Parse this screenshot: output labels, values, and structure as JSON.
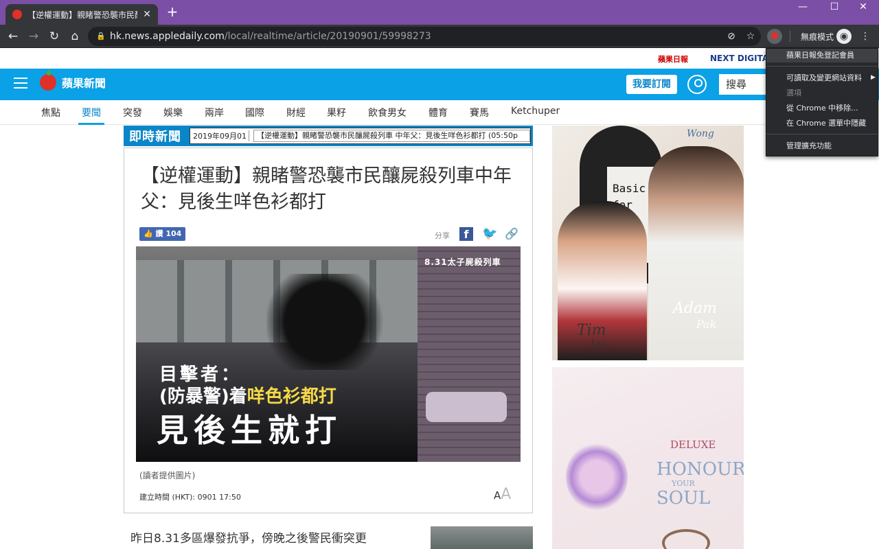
{
  "browser": {
    "tab_title": "【逆權運動】親睹警恐襲市民釀屍",
    "new_tab": "+",
    "url_host": "hk.news.appledaily.com",
    "url_path": "/local/realtime/article/20190901/59998273",
    "incognito_label": "無痕模式",
    "window_controls": {
      "minimize": "—",
      "maximize": "☐",
      "close": "✕"
    }
  },
  "context_menu": {
    "items": [
      {
        "label": "蘋果日報免登記會員",
        "highlighted": true
      },
      {
        "label": "可讀取及變更網站資料",
        "submenu": true
      },
      {
        "label": "選項",
        "disabled": true
      },
      {
        "label": "從 Chrome 中移除..."
      },
      {
        "label": "在 Chrome 選單中隱藏"
      },
      {
        "label": "管理擴充功能"
      }
    ]
  },
  "site": {
    "brand_logos": {
      "apple_daily": "蘋果日報",
      "next_digital": "NEXT DIGITAL"
    },
    "logo_text": "蘋果新聞",
    "subscribe_label": "我要訂閱",
    "search_placeholder": "搜尋",
    "nav_items": [
      "焦點",
      "要聞",
      "突發",
      "娛樂",
      "兩岸",
      "國際",
      "財經",
      "果籽",
      "飲食男女",
      "體育",
      "賽馬",
      "Ketchuper"
    ],
    "active_nav": "要聞"
  },
  "realtime": {
    "label": "即時新聞",
    "date": "2019年09月01",
    "selected": "【逆權運動】親睹警恐襲市民釀屍殺列車 中年父：見後生咩色衫都打 (05:50p"
  },
  "article": {
    "headline": "【逆權運動】親睹警恐襲市民釀屍殺列車中年父：見後生咩色衫都打",
    "like_label": "讚 104",
    "share_label": "分享",
    "photo": {
      "corner_caption": "8.31太子屍殺列車",
      "line1": "目擊者：",
      "line2_a": "(防暴警)着",
      "line2_b": "咩色衫都打",
      "line3": "見後生就打"
    },
    "photo_credit": "(讀者提供圖片)",
    "created_time": "建立時間 (HKT): 0901 17:50",
    "font_small": "A",
    "font_large": "A",
    "first_paragraph": "昨日8.31多區爆發抗爭，傍晚之後警民衝突更"
  },
  "ads": {
    "ad1": {
      "name_top": "Wong",
      "name_tim": "Tim",
      "name_lui": "Lui",
      "name_adam": "Adam",
      "name_pak": "Pak",
      "shirt_text": "Basic for Basi"
    },
    "ad2": {
      "deluxe": "DELUXE",
      "honour": "HONOUR",
      "your": "YOUR",
      "soul": "SOUL"
    }
  }
}
